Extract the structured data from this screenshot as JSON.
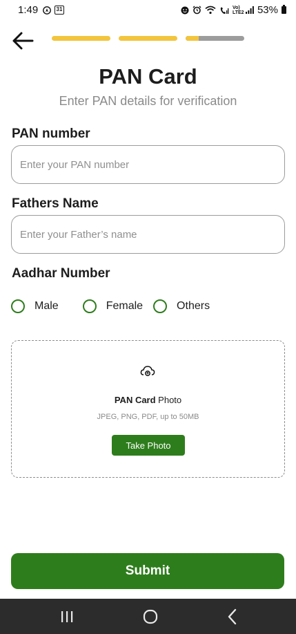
{
  "status_bar": {
    "time": "1:49",
    "calendar_day": "31",
    "volte_label": "Vo) LTE2",
    "battery": "53%"
  },
  "progress": {
    "steps_total": 3,
    "steps_complete": 2,
    "current_step_fraction": 0.22,
    "active_color": "#f2c53d",
    "inactive_color": "#9c9c9c"
  },
  "header": {
    "title": "PAN Card",
    "subtitle": "Enter PAN details for verification"
  },
  "form": {
    "pan_label": "PAN number",
    "pan_placeholder": "Enter your PAN number",
    "pan_value": "",
    "father_label": "Fathers Name",
    "father_placeholder": "Enter your Father’s name",
    "father_value": "",
    "aadhar_label": "Aadhar Number",
    "gender_options": [
      "Male",
      "Female",
      "Others"
    ],
    "gender_selected": null
  },
  "upload": {
    "title_bold": "PAN Card",
    "title_rest": " Photo",
    "hint": "JPEG, PNG, PDF, up to 50MB",
    "button_label": "Take Photo"
  },
  "submit_label": "Submit",
  "colors": {
    "primary_green": "#2e7d1c",
    "accent_yellow": "#f2c53d",
    "nav_bar": "#2c2c2c"
  }
}
